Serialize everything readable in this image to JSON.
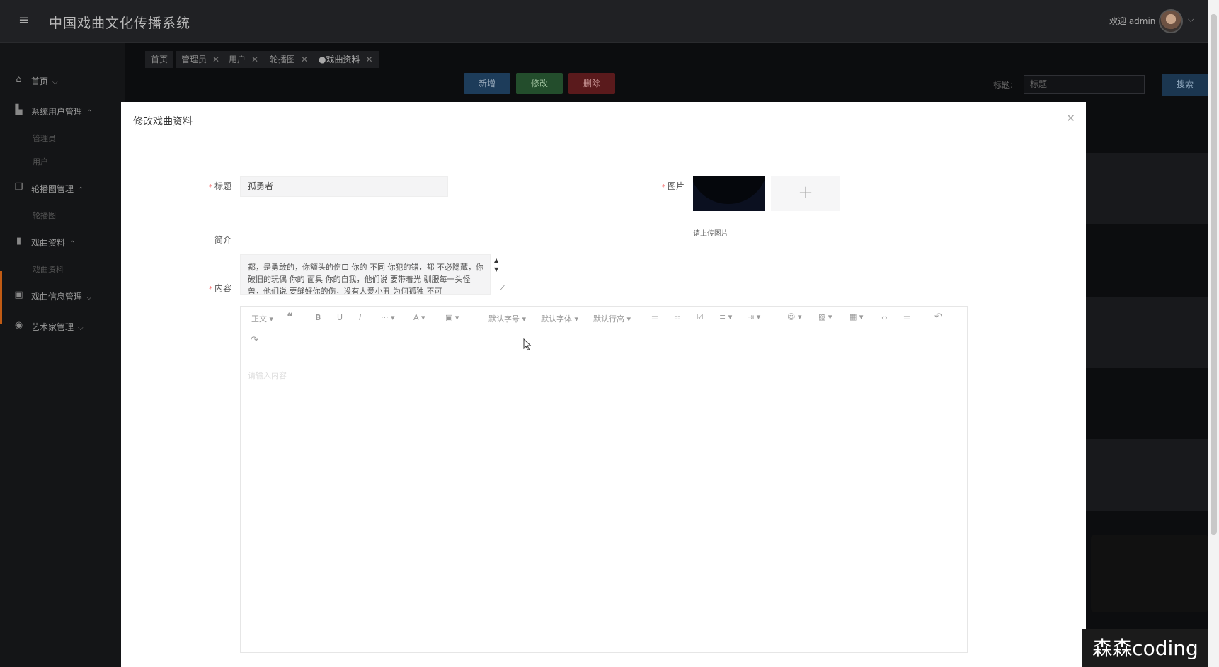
{
  "app": {
    "title": "中国戏曲文化传播系统",
    "welcome": "欢迎 admin"
  },
  "sidebar": {
    "items": [
      {
        "label": "首页",
        "icon": "home-icon"
      },
      {
        "label": "系统用户管理",
        "icon": "building-icon",
        "children": [
          "管理员",
          "用户"
        ]
      },
      {
        "label": "轮播图管理",
        "icon": "copy-icon",
        "children": [
          "轮播图"
        ]
      },
      {
        "label": "戏曲资料",
        "icon": "book-icon",
        "children": [
          "戏曲资料"
        ]
      },
      {
        "label": "戏曲信息管理",
        "icon": "gift-icon"
      },
      {
        "label": "艺术家管理",
        "icon": "compass-icon"
      }
    ]
  },
  "tabs": [
    {
      "label": "首页"
    },
    {
      "label": "管理员"
    },
    {
      "label": "用户"
    },
    {
      "label": "轮播图"
    },
    {
      "label": "●戏曲资料"
    }
  ],
  "toolbar": {
    "add_label": "新增",
    "edit_label": "修改",
    "delete_label": "删除",
    "search_label": "标题:",
    "search_placeholder": "标题",
    "search_button": "搜索"
  },
  "modal": {
    "title": "修改戏曲资料",
    "fields": {
      "title_label": "标题",
      "title_value": "孤勇者",
      "image_label": "图片",
      "image_hint": "请上传图片",
      "intro_label": "简介",
      "intro_value": "都，是勇敢的，你额头的伤口 你的 不同 你犯的错，都 不必隐藏，你破旧的玩偶 你的 面具 你的自我，他们说 要带着光 驯服每一头怪兽，他们说 要缝好你的伤，没有人爱小丑 为何孤独 不可",
      "content_label": "内容"
    },
    "editor": {
      "toolbar": {
        "paragraph": "正文",
        "font_size": "默认字号",
        "font_family": "默认字体",
        "line_height": "默认行高"
      },
      "placeholder": "请输入内容"
    }
  },
  "watermark": "森森coding",
  "colors": {
    "danger": "#f56c6c",
    "accent_active": "#c15b14"
  }
}
